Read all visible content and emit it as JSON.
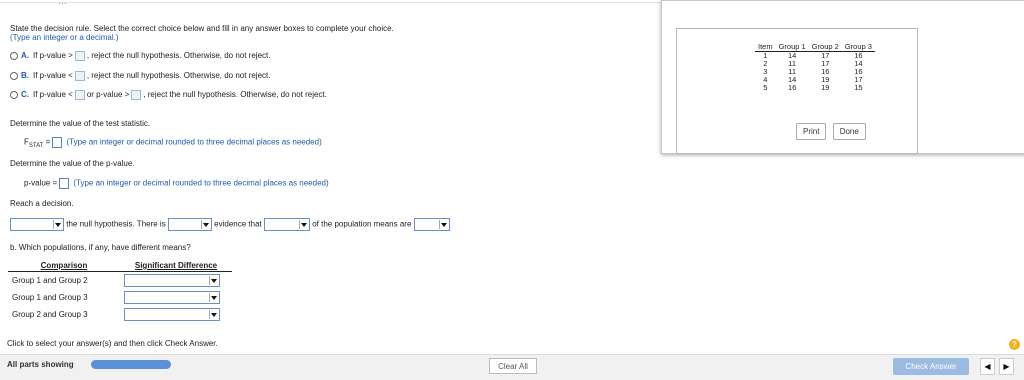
{
  "header": {
    "dots": "…"
  },
  "question": {
    "instruction": "State the decision rule. Select the correct choice below and fill in any answer boxes to complete your choice.",
    "hint": "(Type an integer or a decimal.)",
    "options": [
      {
        "letter": "A.",
        "prefix": "If p-value >",
        "suffix": ", reject the null hypothesis. Otherwise, do not reject."
      },
      {
        "letter": "B.",
        "prefix": "If p-value <",
        "suffix": ", reject the null hypothesis. Otherwise, do not reject."
      },
      {
        "letter": "C.",
        "prefix": "If p-value <",
        "middle": "or p-value >",
        "suffix": ", reject the null hypothesis. Otherwise, do not reject."
      }
    ],
    "stat_prompt": "Determine the value of the test statistic.",
    "fstat_label": "F",
    "fstat_sub": "STAT",
    "fstat_eq": "=",
    "fstat_hint": "(Type an integer or decimal rounded to three decimal places as needed)",
    "pvalue_prompt": "Determine the value of the p-value.",
    "pvalue_label": "p-value =",
    "pvalue_hint": "(Type an integer or decimal rounded to three decimal places as needed)",
    "decision_prompt": "Reach a decision.",
    "decision_text1": "the null hypothesis. There is",
    "decision_text2": "evidence that",
    "decision_text3": "of the population means are",
    "part_b": "b. Which populations, if any, have different means?",
    "comparison_header": "Comparison",
    "significance_header": "Significant Difference",
    "comparisons": [
      "Group 1 and Group 2",
      "Group 1 and Group 3",
      "Group 2 and Group 3"
    ]
  },
  "popup": {
    "table": {
      "headers": [
        "Item",
        "Group 1",
        "Group 2",
        "Group 3"
      ],
      "rows": [
        [
          "1",
          "14",
          "17",
          "16"
        ],
        [
          "2",
          "11",
          "17",
          "14"
        ],
        [
          "3",
          "11",
          "16",
          "16"
        ],
        [
          "4",
          "14",
          "19",
          "17"
        ],
        [
          "5",
          "16",
          "19",
          "15"
        ]
      ]
    },
    "print_label": "Print",
    "done_label": "Done"
  },
  "footer": {
    "instruction": "Click to select your answer(s) and then click Check Answer.",
    "all_parts": "All parts showing",
    "clear_all": "Clear All",
    "check_answer": "Check Answer",
    "help": "?",
    "prev": "◀",
    "next": "▶"
  },
  "colors": {
    "accent": "#1f5ca8",
    "progress": "#5b8fd6",
    "check_button": "#9bbbe3",
    "help": "#f2b21e"
  }
}
